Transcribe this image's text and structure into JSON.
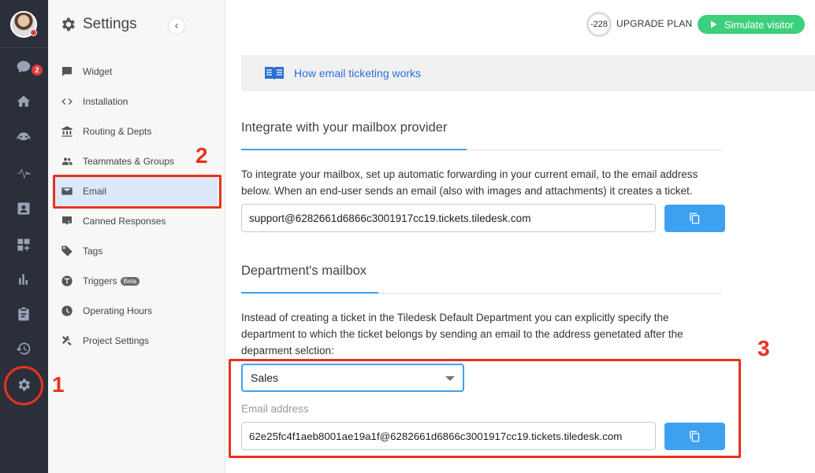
{
  "rail": {
    "notification_count": "2"
  },
  "sidebar": {
    "title": "Settings",
    "items": [
      {
        "label": "Widget",
        "icon": "chat-bubble-icon"
      },
      {
        "label": "Installation",
        "icon": "code-icon"
      },
      {
        "label": "Routing & Depts",
        "icon": "bank-icon"
      },
      {
        "label": "Teammates & Groups",
        "icon": "people-icon"
      },
      {
        "label": "Email",
        "icon": "mail-icon"
      },
      {
        "label": "Canned Responses",
        "icon": "canned-responses-icon"
      },
      {
        "label": "Tags",
        "icon": "tag-icon"
      },
      {
        "label": "Triggers",
        "icon": "triggers-icon",
        "badge": "Beta"
      },
      {
        "label": "Operating Hours",
        "icon": "clock-icon"
      },
      {
        "label": "Project Settings",
        "icon": "tools-icon"
      }
    ]
  },
  "topbar": {
    "credits": "-228",
    "upgrade_label": "UPGRADE PLAN",
    "simulate_label": "Simulate visitor"
  },
  "main": {
    "banner_link": "How email ticketing works",
    "integrate": {
      "heading": "Integrate with your mailbox provider",
      "description": "To integrate your mailbox, set up automatic forwarding in your current email, to the email address below. When an end-user sends an email (also with images and attachments) it creates a ticket.",
      "email": "support@6282661d6866c3001917cc19.tickets.tiledesk.com"
    },
    "department": {
      "heading": "Department's mailbox",
      "description": "Instead of creating a ticket in the Tiledesk Default Department you can explicitly specify the department to which the ticket belongs by sending an email to the address genetated after the deparment selction:",
      "selected_department": "Sales",
      "email_label": "Email address",
      "email": "62e25fc4f1aeb8001ae19a1f@6282661d6866c3001917cc19.tickets.tiledesk.com"
    }
  },
  "annotations": {
    "one": "1",
    "two": "2",
    "three": "3"
  },
  "colors": {
    "annotation": "#e8321e",
    "accent": "#3ea1f0",
    "simulate": "#3ccf7c",
    "rail": "#2b2f3a"
  }
}
